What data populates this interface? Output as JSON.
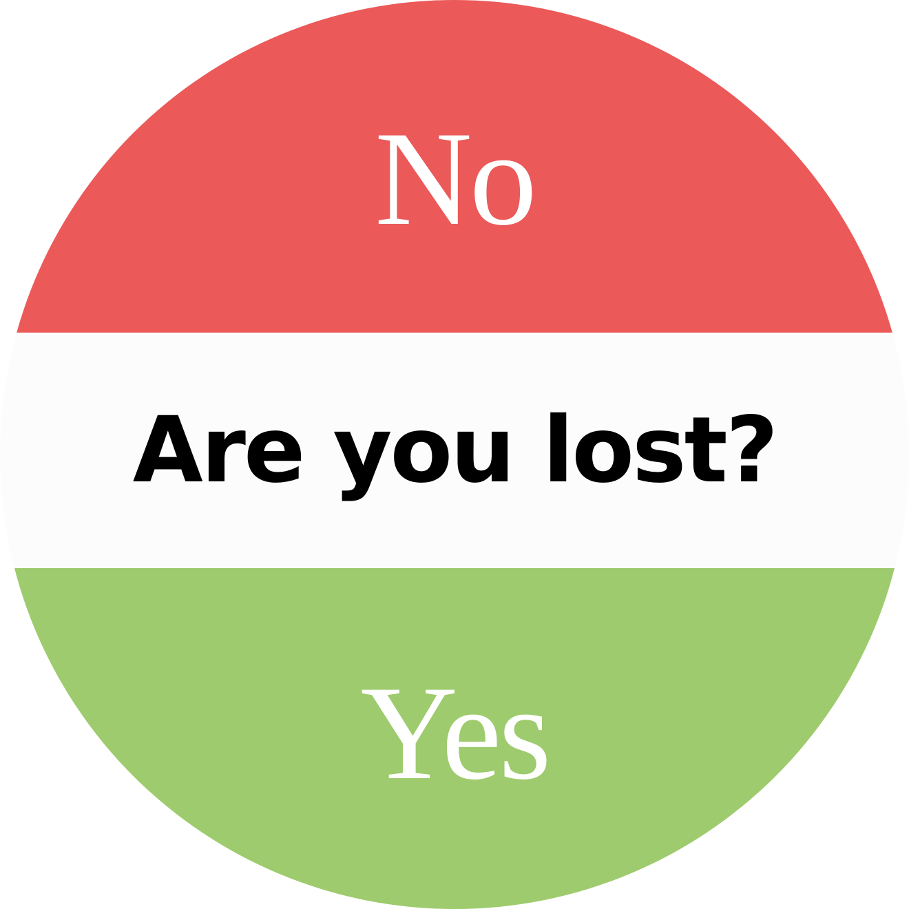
{
  "options": {
    "no": {
      "label": "No",
      "color": "#eb5959"
    },
    "yes": {
      "label": "Yes",
      "color": "#9ecb6d"
    }
  },
  "question": {
    "text": "Are you lost?",
    "background": "#fcfcfc",
    "text_color": "#000000"
  }
}
